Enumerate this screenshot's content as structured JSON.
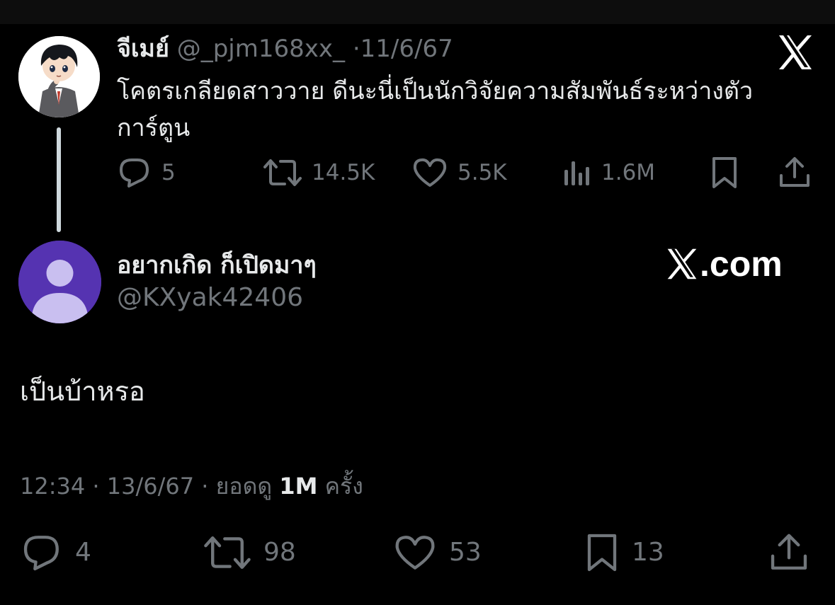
{
  "parent_tweet": {
    "display_name": "จีเมย์",
    "handle": "@_pjm168xx_",
    "separator": "·",
    "date": "11/6/67",
    "text": "โคตรเกลียดสาววาย ดีนะนี่เป็นนักวิจัยความสัมพันธ์ระหว่างตัวการ์ตูน",
    "avatar_icon": "anime-boy-figure-avatar",
    "brand_icon": "x-logo-icon",
    "actions": {
      "replies": "5",
      "retweets": "14.5K",
      "likes": "5.5K",
      "views": "1.6M"
    }
  },
  "reply_tweet": {
    "display_name": "อยากเกิด ก็เปิดมาๆ",
    "handle": "@KXyak42406",
    "text": "เป็นบ้าหรอ",
    "avatar_icon": "default-person-avatar",
    "meta": {
      "time": "12:34",
      "separator1": " · ",
      "date": "13/6/67",
      "separator2": " · ",
      "views_prefix": "ยอดดู ",
      "views": "1M",
      "views_suffix": " ครั้ง"
    },
    "actions": {
      "replies": "4",
      "retweets": "98",
      "likes": "53",
      "bookmarks": "13"
    }
  },
  "watermark": {
    "text": ".com",
    "icon": "x-logo-icon"
  },
  "colors": {
    "background": "#000000",
    "primary_text": "#e7e9ea",
    "secondary_text": "#71767b",
    "reply_avatar_bg": "#5533b1",
    "reply_avatar_fg": "#c9bff0",
    "thread_line": "#cfd9de"
  }
}
